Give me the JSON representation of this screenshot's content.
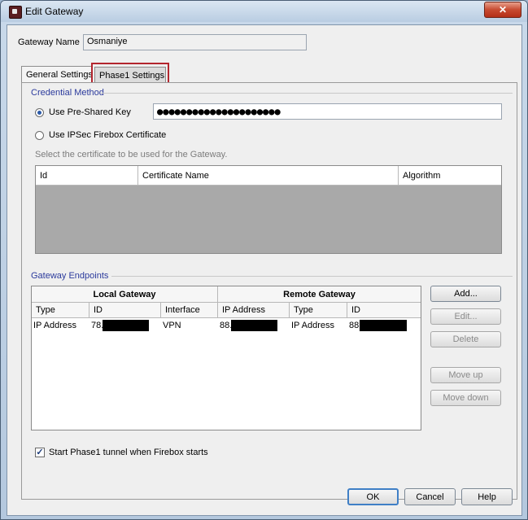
{
  "window": {
    "title": "Edit Gateway",
    "close_glyph": "✕",
    "icon": "firebox-app-icon"
  },
  "gateway_name": {
    "label": "Gateway Name",
    "value": "Osmaniye"
  },
  "tabs": [
    {
      "label": "General Settings",
      "active": true
    },
    {
      "label": "Phase1 Settings",
      "active": false,
      "highlighted": true
    }
  ],
  "credential": {
    "title": "Credential Method",
    "psk_label": "Use Pre-Shared Key",
    "psk_value": "●●●●●●●●●●●●●●●●●●●●●",
    "cert_label": "Use IPSec Firebox Certificate",
    "cert_hint": "Select the certificate to be used for the Gateway.",
    "columns": [
      "Id",
      "Certificate Name",
      "Algorithm"
    ]
  },
  "endpoints": {
    "title": "Gateway Endpoints",
    "local_header": "Local Gateway",
    "remote_header": "Remote Gateway",
    "columns": [
      "Type",
      "ID",
      "Interface",
      "IP Address",
      "Type",
      "ID"
    ],
    "rows": [
      {
        "local_type": "IP Address",
        "local_id": "78.",
        "interface": "VPN",
        "remote_ip": "88.",
        "remote_type": "IP Address",
        "remote_id": "88."
      }
    ],
    "buttons": {
      "add": "Add...",
      "edit": "Edit...",
      "delete": "Delete",
      "move_up": "Move up",
      "move_down": "Move down"
    }
  },
  "start_tunnel": {
    "label": "Start Phase1 tunnel when Firebox starts",
    "checked": true,
    "check_glyph": "✓"
  },
  "footer": {
    "ok": "OK",
    "cancel": "Cancel",
    "help": "Help"
  },
  "colors": {
    "section_title": "#2b3a9c",
    "highlight": "#b3262e",
    "close": "#c74a30"
  }
}
